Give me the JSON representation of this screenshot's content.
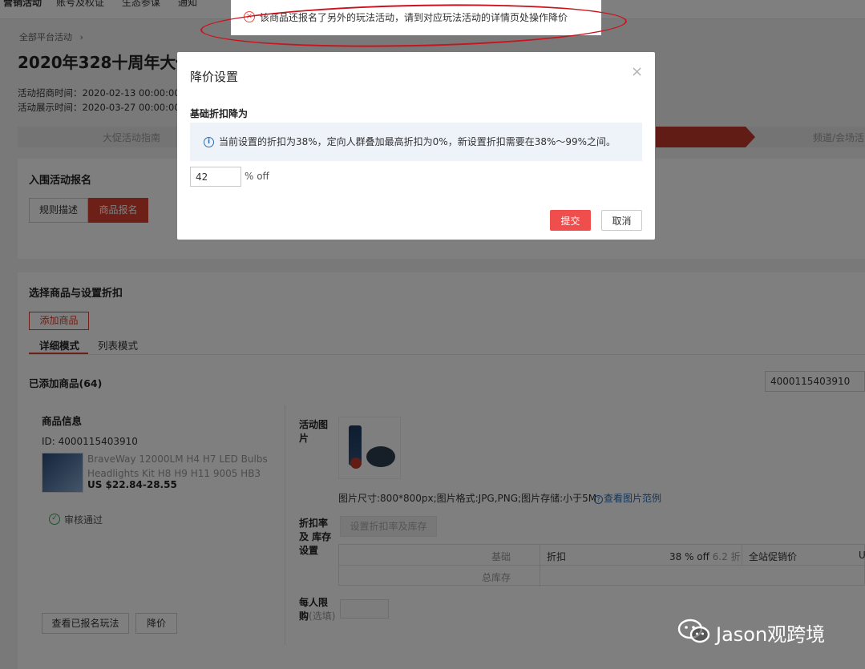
{
  "topnav": {
    "items": [
      "营销活动",
      "账号及权证",
      "生态参谋",
      "通知"
    ]
  },
  "header": {
    "breadcrumb": "全部平台活动",
    "breadcrumb_sep": "›",
    "title": "2020年328十周年大促",
    "recruit_time": "活动招商时间：2020-02-13 00:00:00",
    "display_time": "活动展示时间：2020-03-27 00:00:00"
  },
  "steps": {
    "left_label": "大促活动指南",
    "right_label": "频道/会场活"
  },
  "enroll_card": {
    "title": "入围活动报名",
    "btn_rules": "规则描述",
    "btn_enroll": "商品报名"
  },
  "product_card": {
    "title": "选择商品与设置折扣",
    "add_btn": "添加商品",
    "tab_detail": "详细模式",
    "tab_list": "列表模式",
    "added_label": "已添加商品(64)",
    "search_value": "4000115403910"
  },
  "product": {
    "info_title": "商品信息",
    "id_text": "ID: 4000115403910",
    "name_line1": "BraveWay 12000LM H4 H7 LED Bulbs",
    "name_line2": "Headlights Kit H8 H9 H11 9005 HB3 9...",
    "price": "US $22.84-28.55",
    "status": "审核通过",
    "btn_view": "查看已报名玩法",
    "btn_reduce": "降价"
  },
  "settings": {
    "act_img_label_1": "活动图",
    "act_img_label_2": "片",
    "img_spec": "图片尺寸:800*800px;图片格式:JPG,PNG;图片存储:小于5M",
    "img_example": "查看图片范例",
    "rate_label_1": "折扣率",
    "rate_label_2": "及 库存",
    "rate_label_3": "设置",
    "rate_btn": "设置折扣率及库存",
    "table": {
      "row1_label": "基础",
      "row1_col1": "折扣",
      "row1_val": "38 % off",
      "row1_fold": "6.2 折",
      "row1_col3": "全站促销价",
      "row1_col4": "U",
      "row2_label": "总库存"
    },
    "limit_label_1": "每人限",
    "limit_label_2": "购",
    "limit_optional": "(选填)"
  },
  "toast": {
    "icon": "error-icon",
    "message": "该商品还报名了另外的玩法活动，请到对应玩法活动的详情页处操作降价"
  },
  "modal": {
    "title": "降价设置",
    "close": "×",
    "label": "基础折扣降为",
    "info": "当前设置的折扣为38%，定向人群叠加最高折扣为0%，新设置折扣需要在38%～99%之间。",
    "input_value": "42",
    "unit": "% off",
    "submit": "提交",
    "cancel": "取消"
  },
  "watermark": {
    "text": "Jason观跨境"
  },
  "colors": {
    "accent_red": "#d9412f",
    "submit_red": "#f04d4d",
    "info_bg": "#eef3fa",
    "annotation_red": "#c8141e",
    "success_green": "#3aa65b"
  }
}
